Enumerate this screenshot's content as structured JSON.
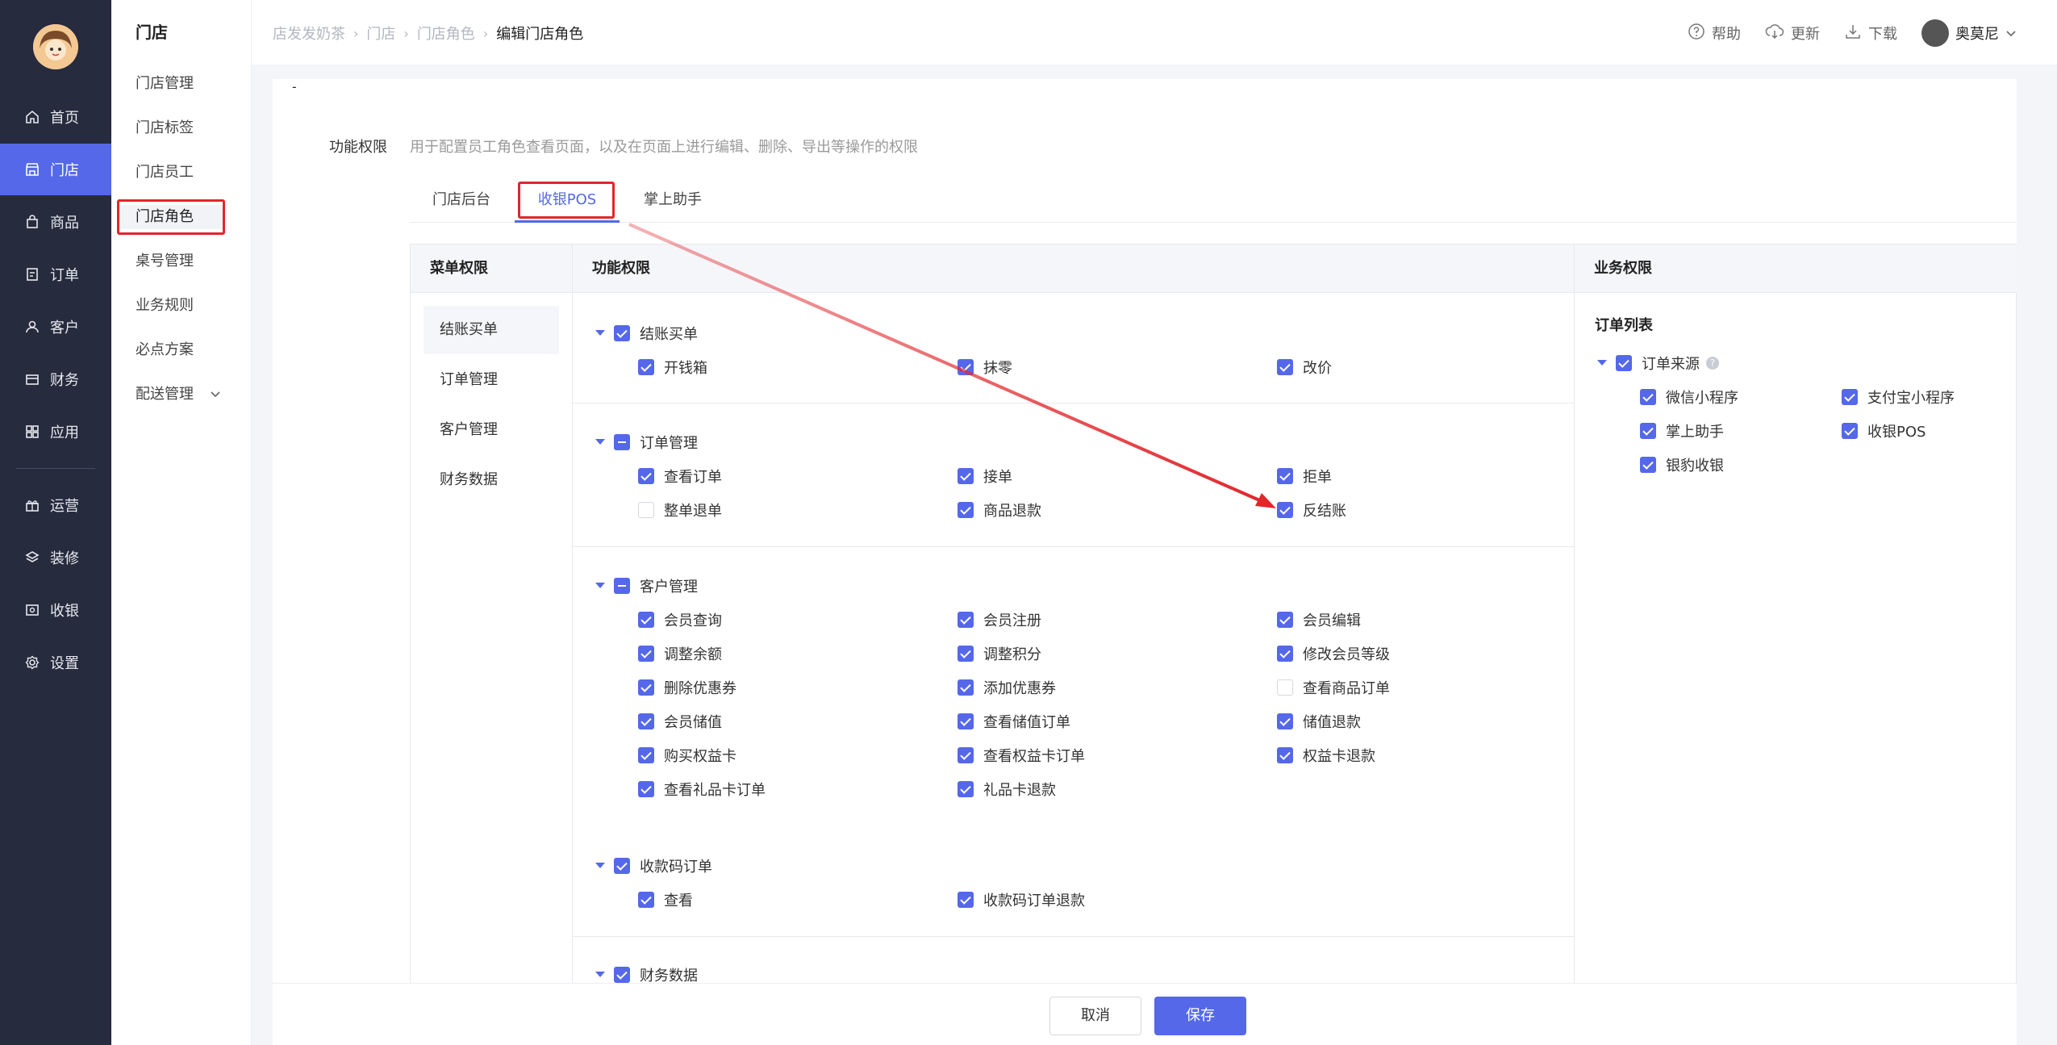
{
  "nav": {
    "items": [
      {
        "label": "首页",
        "icon": "home-icon"
      },
      {
        "label": "门店",
        "icon": "store-icon"
      },
      {
        "label": "商品",
        "icon": "bag-icon"
      },
      {
        "label": "订单",
        "icon": "order-icon"
      },
      {
        "label": "客户",
        "icon": "user-icon"
      },
      {
        "label": "财务",
        "icon": "wallet-icon"
      },
      {
        "label": "应用",
        "icon": "apps-icon"
      },
      {
        "label": "运营",
        "icon": "gift-icon"
      },
      {
        "label": "装修",
        "icon": "layers-icon"
      },
      {
        "label": "收银",
        "icon": "cashier-icon"
      },
      {
        "label": "设置",
        "icon": "gear-icon"
      }
    ],
    "active_index": 1
  },
  "subnav": {
    "title": "门店",
    "items": [
      "门店管理",
      "门店标签",
      "门店员工",
      "门店角色",
      "桌号管理",
      "业务规则",
      "必点方案",
      "配送管理"
    ],
    "active_index": 3
  },
  "breadcrumb": [
    "店发发奶茶",
    "门店",
    "门店角色",
    "编辑门店角色"
  ],
  "topbar": {
    "help": "帮助",
    "update": "更新",
    "download": "下载",
    "user": "奥莫尼"
  },
  "card": {
    "dash": "-",
    "perm_label": "功能权限",
    "perm_desc": "用于配置员工角色查看页面，以及在页面上进行编辑、删除、导出等操作的权限",
    "tabs": [
      "门店后台",
      "收银POS",
      "掌上助手"
    ],
    "active_tab": 1
  },
  "table": {
    "headers": {
      "menu": "菜单权限",
      "func": "功能权限",
      "biz": "业务权限"
    },
    "menu_items": [
      "结账买单",
      "订单管理",
      "客户管理",
      "财务数据"
    ],
    "groups": [
      {
        "name": "结账买单",
        "state": "on",
        "items": [
          {
            "label": "开钱箱",
            "on": true
          },
          {
            "label": "抹零",
            "on": true
          },
          {
            "label": "改价",
            "on": true
          }
        ]
      },
      {
        "name": "订单管理",
        "state": "half",
        "items": [
          {
            "label": "查看订单",
            "on": true
          },
          {
            "label": "接单",
            "on": true
          },
          {
            "label": "拒单",
            "on": true
          },
          {
            "label": "整单退单",
            "on": false
          },
          {
            "label": "商品退款",
            "on": true
          },
          {
            "label": "反结账",
            "on": true
          }
        ]
      },
      {
        "name": "客户管理",
        "state": "half",
        "items": [
          {
            "label": "会员查询",
            "on": true
          },
          {
            "label": "会员注册",
            "on": true
          },
          {
            "label": "会员编辑",
            "on": true
          },
          {
            "label": "调整余额",
            "on": true
          },
          {
            "label": "调整积分",
            "on": true
          },
          {
            "label": "修改会员等级",
            "on": true
          },
          {
            "label": "删除优惠券",
            "on": true
          },
          {
            "label": "添加优惠券",
            "on": true
          },
          {
            "label": "查看商品订单",
            "on": false
          },
          {
            "label": "会员储值",
            "on": true
          },
          {
            "label": "查看储值订单",
            "on": true
          },
          {
            "label": "储值退款",
            "on": true
          },
          {
            "label": "购买权益卡",
            "on": true
          },
          {
            "label": "查看权益卡订单",
            "on": true
          },
          {
            "label": "权益卡退款",
            "on": true
          },
          {
            "label": "查看礼品卡订单",
            "on": true
          },
          {
            "label": "礼品卡退款",
            "on": true
          }
        ]
      },
      {
        "name": "收款码订单",
        "state": "on",
        "items": [
          {
            "label": "查看",
            "on": true
          },
          {
            "label": "收款码订单退款",
            "on": true
          }
        ]
      },
      {
        "name": "财务数据",
        "state": "on",
        "items": []
      }
    ],
    "biz": {
      "section_title": "订单列表",
      "group": "订单来源",
      "help": "?",
      "items": [
        "微信小程序",
        "支付宝小程序",
        "掌上助手",
        "收银POS",
        "银豹收银"
      ]
    }
  },
  "footer": {
    "cancel": "取消",
    "save": "保存"
  },
  "colors": {
    "accent": "#5468e9",
    "nav_bg": "#262b3d",
    "highlight": "#e2262b"
  }
}
